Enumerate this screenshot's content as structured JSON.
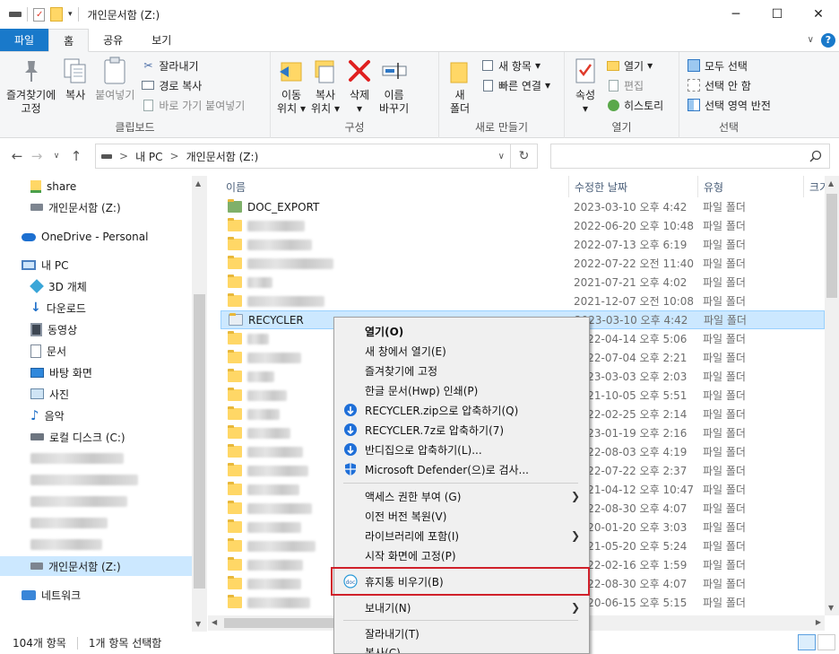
{
  "window": {
    "title": "개인문서함 (Z:)",
    "controls": [
      "─",
      "☐",
      "✕"
    ]
  },
  "ribbon_tabs": [
    "파일",
    "홈",
    "공유",
    "보기"
  ],
  "ribbon": {
    "clipboard": {
      "label": "클립보드",
      "pin": [
        "즐겨찾기에",
        "고정"
      ],
      "copy": "복사",
      "paste": "붙여넣기",
      "cut": "잘라내기",
      "copy_path": "경로 복사",
      "paste_shortcut": "바로 가기 붙여넣기"
    },
    "organize": {
      "label": "구성",
      "move": [
        "이동",
        "위치"
      ],
      "copyto": [
        "복사",
        "위치"
      ],
      "delete": "삭제",
      "rename": [
        "이름",
        "바꾸기"
      ]
    },
    "new": {
      "label": "새로 만들기",
      "new_folder": [
        "새",
        "폴더"
      ],
      "new_item": "새 항목",
      "easy_access": "빠른 연결"
    },
    "open": {
      "label": "열기",
      "properties": "속성",
      "open": "열기",
      "edit": "편집",
      "history": "히스토리"
    },
    "select": {
      "label": "선택",
      "all": "모두 선택",
      "none": "선택 안 함",
      "invert": "선택 영역 반전"
    }
  },
  "address": {
    "path": [
      "내 PC",
      "개인문서함 (Z:)"
    ],
    "separator": ">"
  },
  "navpane": {
    "share": "share",
    "drive_z": "개인문서함 (Z:)",
    "onedrive": "OneDrive - Personal",
    "mypc": "내 PC",
    "objects3d": "3D 개체",
    "downloads": "다운로드",
    "videos": "동영상",
    "documents": "문서",
    "desktop": "바탕 화면",
    "pictures": "사진",
    "music": "음악",
    "local_c": "로컬 디스크 (C:)",
    "drive_z_selected": "개인문서함 (Z:)",
    "network": "네트워크"
  },
  "columns": {
    "name": "이름",
    "date": "수정한 날짜",
    "type": "유형",
    "size": "크기"
  },
  "files": [
    {
      "name": "DOC_EXPORT",
      "date": "2023-03-10 오후 4:42",
      "type": "파일 폴더"
    },
    {
      "name": "",
      "date": "2022-06-20 오후 10:48",
      "type": "파일 폴더"
    },
    {
      "name": "",
      "date": "2022-07-13 오후 6:19",
      "type": "파일 폴더"
    },
    {
      "name": "",
      "date": "2022-07-22 오전 11:40",
      "type": "파일 폴더"
    },
    {
      "name": "",
      "date": "2021-07-21 오후 4:02",
      "type": "파일 폴더"
    },
    {
      "name": "",
      "date": "2021-12-07 오전 10:08",
      "type": "파일 폴더"
    },
    {
      "name": "RECYCLER",
      "date": "2023-03-10 오후 4:42",
      "type": "파일 폴더"
    },
    {
      "name": "",
      "date": "2022-04-14 오후 5:06",
      "type": "파일 폴더"
    },
    {
      "name": "",
      "date": "2022-07-04 오후 2:21",
      "type": "파일 폴더"
    },
    {
      "name": "",
      "date": "2023-03-03 오후 2:03",
      "type": "파일 폴더"
    },
    {
      "name": "",
      "date": "2021-10-05 오후 5:51",
      "type": "파일 폴더"
    },
    {
      "name": "",
      "date": "2022-02-25 오후 2:14",
      "type": "파일 폴더"
    },
    {
      "name": "",
      "date": "2023-01-19 오후 2:16",
      "type": "파일 폴더"
    },
    {
      "name": "",
      "date": "2022-08-03 오후 4:19",
      "type": "파일 폴더"
    },
    {
      "name": "",
      "date": "2022-07-22 오후 2:37",
      "type": "파일 폴더"
    },
    {
      "name": "",
      "date": "2021-04-12 오후 10:47",
      "type": "파일 폴더"
    },
    {
      "name": "",
      "date": "2022-08-30 오후 4:07",
      "type": "파일 폴더"
    },
    {
      "name": "",
      "date": "2020-01-20 오후 3:03",
      "type": "파일 폴더"
    },
    {
      "name": "",
      "date": "2021-05-20 오후 5:24",
      "type": "파일 폴더"
    },
    {
      "name": "",
      "date": "2022-02-16 오후 1:59",
      "type": "파일 폴더"
    },
    {
      "name": "",
      "date": "2022-08-30 오후 4:07",
      "type": "파일 폴더"
    },
    {
      "name": "",
      "date": "2020-06-15 오후 5:15",
      "type": "파일 폴더"
    }
  ],
  "context_menu": {
    "open": "열기(O)",
    "open_new": "새 창에서 열기(E)",
    "pin_quick": "즐겨찾기에 고정",
    "hwp_print": "한글 문서(Hwp) 인쇄(P)",
    "zip": "RECYCLER.zip으로 압축하기(Q)",
    "sevenz": "RECYCLER.7z로 압축하기(7)",
    "bandizip": "반디집으로 압축하기(L)...",
    "defender": "Microsoft Defender(으)로 검사...",
    "access": "액세스 권한 부여 (G)",
    "restore": "이전 버전 복원(V)",
    "library": "라이브러리에 포함(I)",
    "pin_start": "시작 화면에 고정(P)",
    "empty_recycle": "휴지통 비우기(B)",
    "send_to": "보내기(N)",
    "cut": "잘라내기(T)",
    "copy": "복사(C)"
  },
  "status": {
    "count": "104개 항목",
    "selected": "1개 항목 선택함"
  },
  "colors": {
    "accent": "#1979ca",
    "selection": "#cce8ff",
    "highlight": "#d0202a"
  }
}
